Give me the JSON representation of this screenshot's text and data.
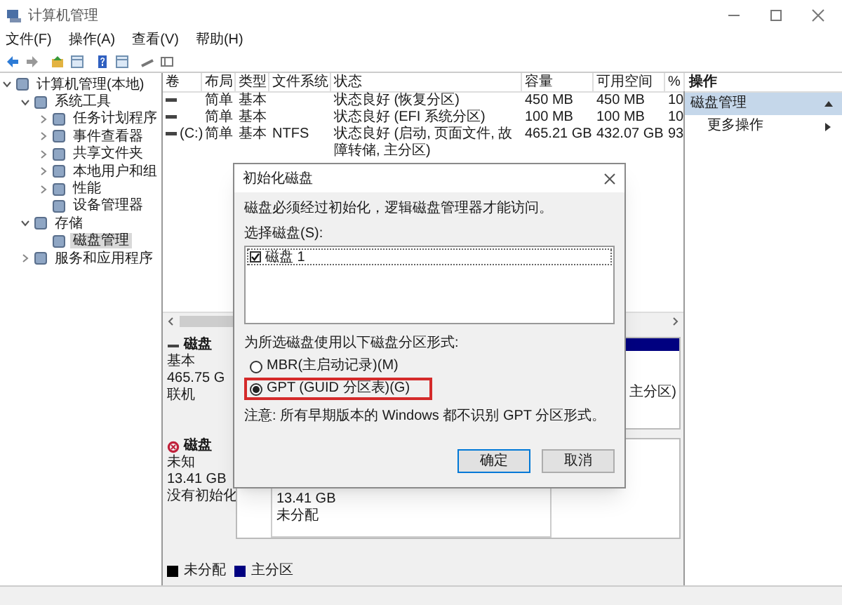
{
  "window": {
    "title": "计算机管理"
  },
  "menu": [
    "文件(F)",
    "操作(A)",
    "查看(V)",
    "帮助(H)"
  ],
  "tree": [
    {
      "label": "计算机管理(本地)",
      "selected": false,
      "expanded": true,
      "children": [
        {
          "label": "系统工具",
          "selected": false,
          "expanded": true,
          "children": [
            {
              "label": "任务计划程序",
              "selected": false,
              "expanded": false
            },
            {
              "label": "事件查看器",
              "selected": false,
              "expanded": false
            },
            {
              "label": "共享文件夹",
              "selected": false,
              "expanded": false
            },
            {
              "label": "本地用户和组",
              "selected": false,
              "expanded": false
            },
            {
              "label": "性能",
              "selected": false,
              "expanded": false
            },
            {
              "label": "设备管理器",
              "selected": false
            }
          ]
        },
        {
          "label": "存储",
          "selected": false,
          "expanded": true,
          "children": [
            {
              "label": "磁盘管理",
              "selected": true
            }
          ]
        },
        {
          "label": "服务和应用程序",
          "selected": false,
          "expanded": false
        }
      ]
    }
  ],
  "table": {
    "columns": [
      "卷",
      "布局",
      "类型",
      "文件系统",
      "状态",
      "容量",
      "可用空间",
      "%"
    ],
    "rows": [
      [
        "",
        "简单",
        "基本",
        "",
        "状态良好 (恢复分区)",
        "450 MB",
        "450 MB",
        "10"
      ],
      [
        "",
        "简单",
        "基本",
        "",
        "状态良好 (EFI 系统分区)",
        "100 MB",
        "100 MB",
        "10"
      ],
      [
        "(C:)",
        "简单",
        "基本",
        "NTFS",
        "状态良好 (启动, 页面文件, 故障转储, 主分区)",
        "465.21 GB",
        "432.07 GB",
        "93"
      ]
    ]
  },
  "disks": [
    {
      "name": "磁盘",
      "lines": [
        "基本",
        "465.75 G",
        "联机"
      ],
      "initialized": true,
      "partition": {
        "color": "#000080",
        "lines": [
          "主分区)"
        ]
      }
    },
    {
      "name": "磁盘",
      "lines": [
        "未知",
        "13.41 GB",
        "没有初始化"
      ],
      "initialized": false,
      "partition": {
        "lines": [
          "13.41 GB",
          "未分配"
        ]
      }
    }
  ],
  "legend": [
    {
      "label": "未分配",
      "color": "#000000"
    },
    {
      "label": "主分区",
      "color": "#000080"
    }
  ],
  "actions": {
    "title": "操作",
    "items": [
      {
        "label": "磁盘管理",
        "selected": true,
        "kind": "section"
      },
      {
        "label": "更多操作",
        "selected": false,
        "kind": "submenu"
      }
    ]
  },
  "dialog": {
    "title": "初始化磁盘",
    "message": "磁盘必须经过初始化，逻辑磁盘管理器才能访问。",
    "list_label": "选择磁盘(S):",
    "disks": [
      {
        "label": "磁盘 1",
        "checked": true
      }
    ],
    "style_label": "为所选磁盘使用以下磁盘分区形式:",
    "options": [
      {
        "label": "MBR(主启动记录)(M)",
        "selected": false,
        "highlighted": false
      },
      {
        "label": "GPT (GUID 分区表)(G)",
        "selected": true,
        "highlighted": true
      }
    ],
    "note": "注意: 所有早期版本的 Windows 都不识别 GPT 分区形式。",
    "buttons": [
      {
        "label": "确定",
        "default": true
      },
      {
        "label": "取消",
        "default": false
      }
    ]
  }
}
